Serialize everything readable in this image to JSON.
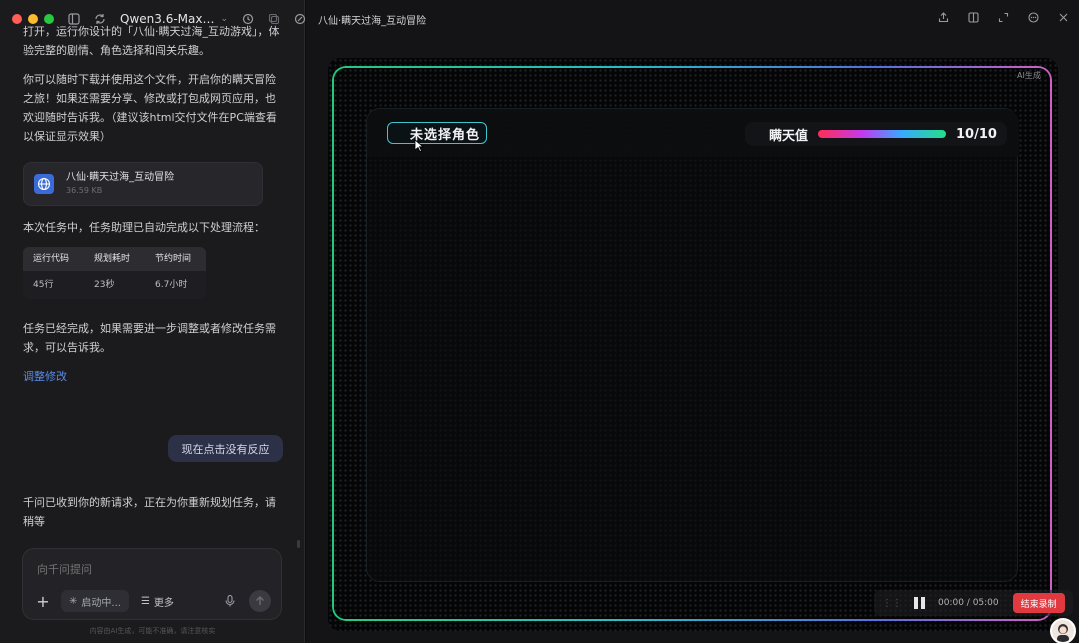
{
  "window": {
    "tab_title": "Qwen3.6-Max…"
  },
  "chat": {
    "intro_fragment": "打开，运行你设计的「八仙·瞒天过海_互动游戏」，体验完整的剧情、角色选择和闯关乐趣。",
    "download_note": "你可以随时下载并使用这个文件，开启你的瞒天冒险之旅！如果还需要分享、修改或打包成网页应用，也欢迎随时告诉我。（建议该html交付文件在PC端查看以保证显示效果）",
    "file": {
      "name": "八仙·瞒天过海_互动冒险",
      "size": "36.59 KB",
      "icon": "globe-icon"
    },
    "process_intro": "本次任务中，任务助理已自动完成以下处理流程：",
    "stats": {
      "headers": [
        "运行代码",
        "规划耗时",
        "节约时间"
      ],
      "values": [
        "45行",
        "23秒",
        "6.7小时"
      ]
    },
    "done_text": "任务已经完成，如果需要进一步调整或者修改任务需求，可以告诉我。",
    "adjust_link": "调整修改",
    "user_message": "现在点击没有反应",
    "assistant_reply": "千问已收到你的新请求，正在为你重新规划任务，请稍等"
  },
  "composer": {
    "placeholder": "向千问提问",
    "status_chip": "启动中...",
    "more_label": "更多",
    "disclaimer": "内容由AI生成，可能不准确，请注意核实"
  },
  "preview": {
    "title": "八仙·瞒天过海_互动冒险",
    "ai_badge": "AI生成",
    "role_button": "未选择角色",
    "hp_label": "瞒天值",
    "hp_value": "10/10",
    "hp_fraction": 1.0
  },
  "recorder": {
    "time": "00:00 / 05:00",
    "stop_label": "结束录制"
  },
  "colors": {
    "accent_blue": "#5b8be8",
    "record_red": "#e03a40",
    "role_border": "#3bc6d2"
  }
}
